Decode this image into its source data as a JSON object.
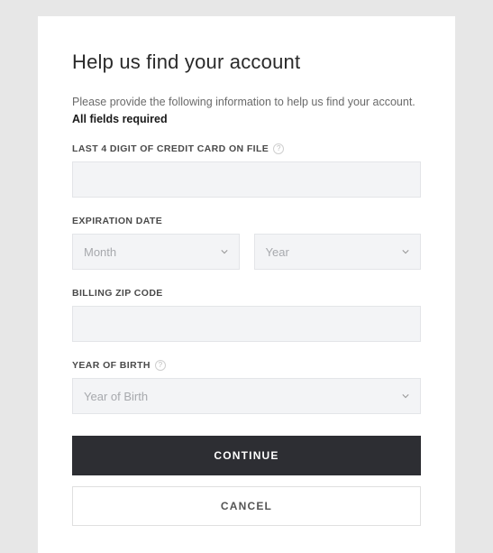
{
  "title": "Help us find your account",
  "description": "Please provide the following information to help us find your account.",
  "required_note": "All fields required",
  "fields": {
    "last4": {
      "label": "LAST 4 DIGIT OF CREDIT CARD ON FILE",
      "value": ""
    },
    "expiration": {
      "label": "EXPIRATION DATE",
      "month_placeholder": "Month",
      "year_placeholder": "Year"
    },
    "zip": {
      "label": "BILLING ZIP CODE",
      "value": ""
    },
    "birth": {
      "label": "YEAR OF BIRTH",
      "placeholder": "Year of Birth"
    }
  },
  "buttons": {
    "continue": "CONTINUE",
    "cancel": "CANCEL"
  }
}
